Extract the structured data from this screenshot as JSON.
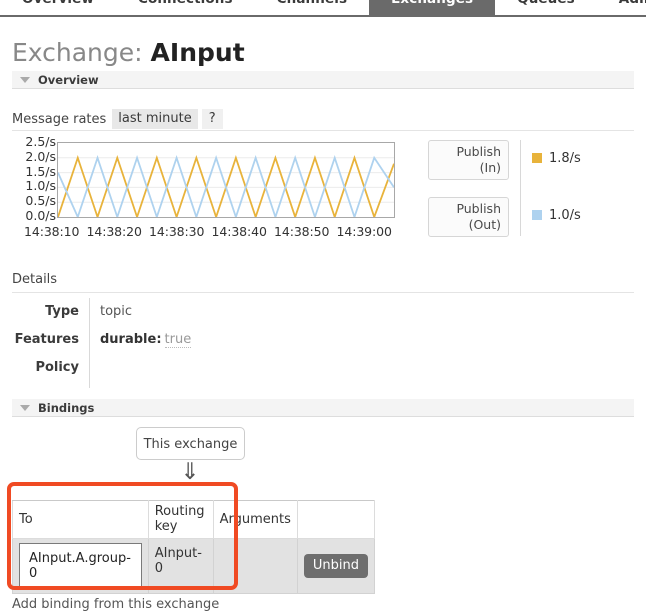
{
  "nav": {
    "items": [
      {
        "label": "Overview",
        "active": false
      },
      {
        "label": "Connections",
        "active": false
      },
      {
        "label": "Channels",
        "active": false
      },
      {
        "label": "Exchanges",
        "active": true
      },
      {
        "label": "Queues",
        "active": false
      },
      {
        "label": "Admin",
        "active": false
      }
    ]
  },
  "page": {
    "title_prefix": "Exchange:",
    "title_object": "AInput"
  },
  "overview": {
    "section_label": "Overview",
    "rates_label": "Message rates",
    "period_button": "last minute",
    "help_button": "?"
  },
  "chart_data": {
    "type": "line",
    "title": "Message rates",
    "xlabel": "",
    "ylabel": "",
    "ylim": [
      0.0,
      2.5
    ],
    "grid": true,
    "legend_position": "right",
    "ytick_labels": [
      "2.5/s",
      "2.0/s",
      "1.5/s",
      "1.0/s",
      "0.5/s",
      "0.0/s"
    ],
    "ytick_values": [
      2.5,
      2.0,
      1.5,
      1.0,
      0.5,
      0.0
    ],
    "xtick_labels": [
      "14:38:10",
      "14:38:20",
      "14:38:30",
      "14:38:40",
      "14:38:50",
      "14:39:00"
    ],
    "series": [
      {
        "name": "Publish (In)",
        "color": "#e8b33b",
        "current_value": "1.8/s",
        "values": [
          0.0,
          2.0,
          0.0,
          2.0,
          0.0,
          2.0,
          0.0,
          2.0,
          0.0,
          2.0,
          0.0,
          2.0,
          0.0,
          2.0,
          0.0,
          2.0,
          0.0,
          1.8
        ]
      },
      {
        "name": "Publish (Out)",
        "color": "#aed2ef",
        "current_value": "1.0/s",
        "values": [
          1.5,
          0.0,
          2.0,
          0.0,
          2.0,
          0.0,
          2.0,
          0.0,
          2.0,
          0.0,
          2.0,
          0.0,
          2.0,
          0.0,
          2.0,
          0.0,
          2.0,
          1.0
        ]
      }
    ]
  },
  "legend": {
    "rows": [
      {
        "button_line1": "Publish",
        "button_line2": "(In)",
        "value": "1.8/s",
        "color": "#e8b33b"
      },
      {
        "button_line1": "Publish",
        "button_line2": "(Out)",
        "value": "1.0/s",
        "color": "#aed2ef"
      }
    ]
  },
  "details": {
    "label": "Details",
    "rows": [
      {
        "key": "Type",
        "value": "topic"
      },
      {
        "key": "Features",
        "feature_key": "durable:",
        "feature_value": "true"
      },
      {
        "key": "Policy",
        "value": ""
      }
    ]
  },
  "bindings": {
    "section_label": "Bindings",
    "this_exchange": "This exchange",
    "arrow_icon": "down-double-arrow-icon",
    "columns": [
      "To",
      "Routing key",
      "Arguments",
      ""
    ],
    "rows": [
      {
        "to": "AInput.A.group-0",
        "routing_key": "AInput-0",
        "arguments": "",
        "action": "Unbind"
      }
    ],
    "add_binding_link": "Add binding from this exchange"
  },
  "colors": {
    "highlight": "#f04a23",
    "active_tab_bg": "#6a6a6a",
    "series_in": "#e8b33b",
    "series_out": "#aed2ef"
  }
}
